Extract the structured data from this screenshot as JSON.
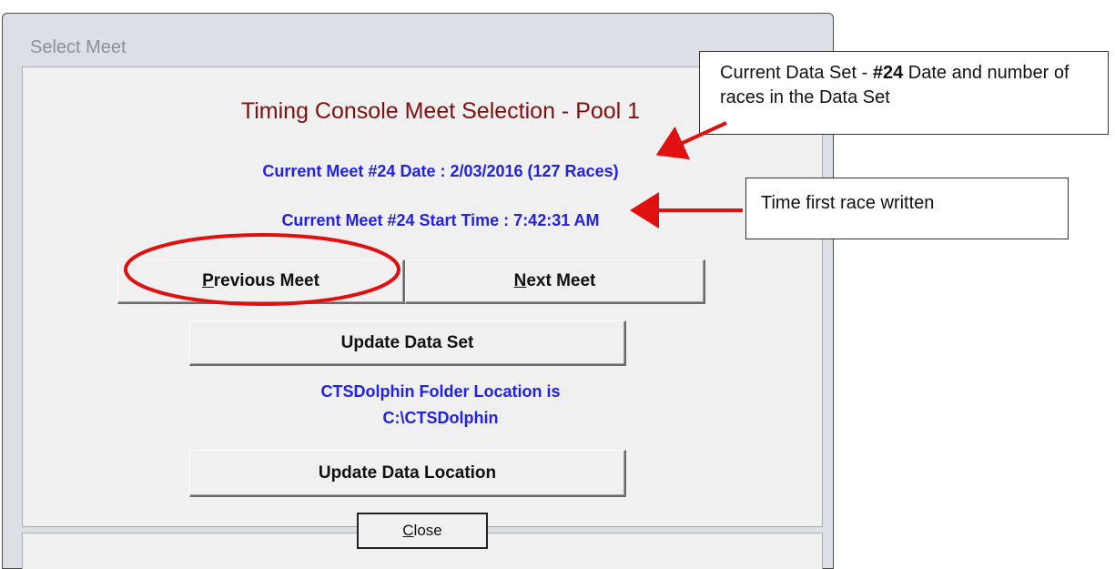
{
  "window": {
    "title": "Select Meet"
  },
  "main": {
    "heading": "Timing Console Meet Selection - Pool 1",
    "meet_date_line": "Current Meet #24 Date : 2/03/2016 (127 Races)",
    "meet_start_line": "Current Meet #24 Start Time : 7:42:31 AM",
    "folder_line1": "CTSDolphin Folder Location is",
    "folder_line2": "C:\\CTSDolphin"
  },
  "buttons": {
    "previous_meet": {
      "mnemonic": "P",
      "rest": "revious Meet"
    },
    "next_meet": {
      "mnemonic": "N",
      "rest": "ext Meet"
    },
    "update_data_set": "Update Data Set",
    "update_data_location": "Update Data Location",
    "close": {
      "mnemonic": "C",
      "rest": "lose"
    }
  },
  "annotations": {
    "callout_data_set": {
      "prefix": "Current Data Set - ",
      "emphasis": "#24",
      "suffix": " Date and number of races in the Data Set"
    },
    "callout_time": "Time first race written",
    "accent_color": "#e01010"
  },
  "colors": {
    "heading": "#7e1010",
    "info_text": "#2222e6"
  }
}
